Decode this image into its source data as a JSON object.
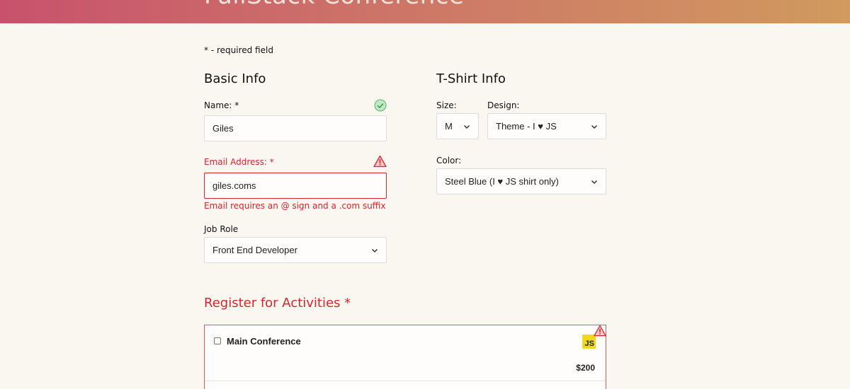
{
  "header": {
    "title": "FullStack Conference"
  },
  "form": {
    "required_note": "* - required field",
    "basic_info": {
      "title": "Basic Info",
      "name": {
        "label": "Name:",
        "required_mark": "*",
        "value": "Giles"
      },
      "email": {
        "label": "Email Address:",
        "required_mark": "*",
        "value": "giles.coms",
        "error": "Email requires an @ sign and a .com suffix"
      },
      "job_role": {
        "label": "Job Role",
        "value": "Front End Developer"
      }
    },
    "tshirt_info": {
      "title": "T-Shirt Info",
      "size": {
        "label": "Size:",
        "value": "M"
      },
      "design": {
        "label": "Design:",
        "value": "Theme - I ♥ JS"
      },
      "color": {
        "label": "Color:",
        "value": "Steel Blue (I ♥ JS shirt only)"
      }
    },
    "activities": {
      "title": "Register for Activities",
      "required_mark": "*",
      "items": [
        {
          "name": "Main Conference",
          "badge": "JS",
          "cost": "$200"
        }
      ]
    }
  },
  "colors": {
    "error": "#d8242f",
    "valid": "#8fd49a",
    "header_start": "#c8526c",
    "header_end": "#d19a5e"
  }
}
